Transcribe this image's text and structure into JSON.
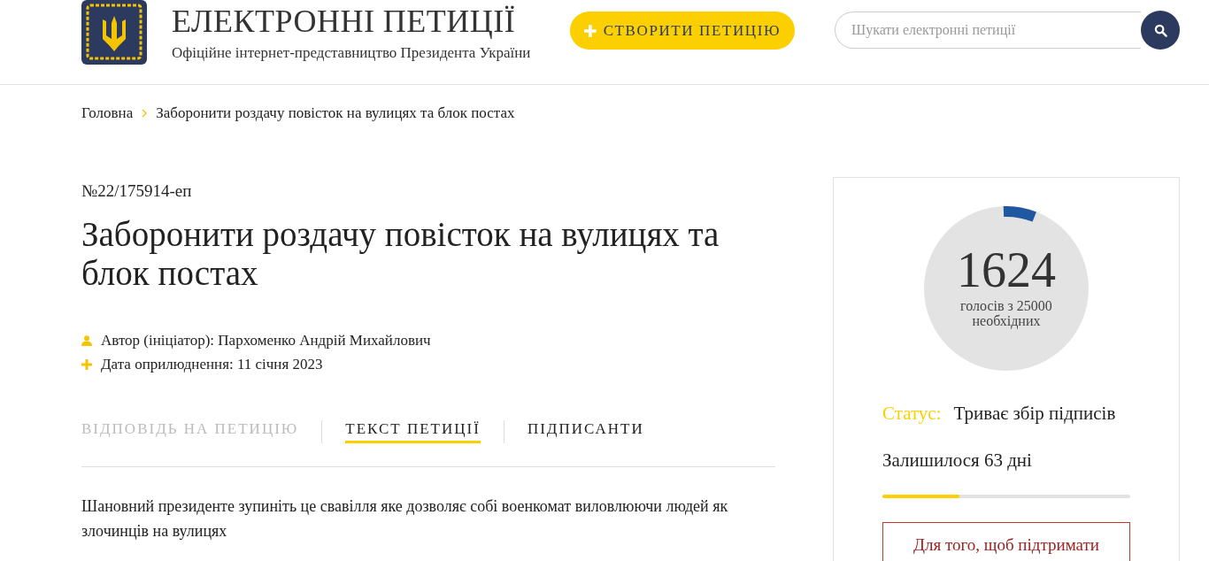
{
  "header": {
    "title": "ЕЛЕКТРОННІ ПЕТИЦІЇ",
    "subtitle": "Офіційне інтернет-представництво Президента України",
    "create_button": "СТВОРИТИ ПЕТИЦІЮ",
    "search": {
      "placeholder": "Шукати електронні петиції"
    }
  },
  "breadcrumbs": [
    "Головна",
    "Заборонити роздачу повісток на вулицях та блок постах"
  ],
  "petition": {
    "number": "№22/175914-еп",
    "title": "Заборонити роздачу повісток на вулицях та блок постах",
    "meta": [
      {
        "kind": "author",
        "text": "Автор (ініціатор): Пархоменко Андрій Михайлович"
      },
      {
        "kind": "date",
        "text": "Дата оприлюднення: 11 січня 2023"
      }
    ],
    "tabs": [
      {
        "label": "ВІДПОВІДЬ НА ПЕТИЦІЮ",
        "selected": false,
        "disabled": true
      },
      {
        "label": "ТЕКСТ ПЕТИЦІЇ",
        "selected": true,
        "disabled": false
      },
      {
        "label": "ПІДПИСАНТИ",
        "selected": false,
        "disabled": false
      }
    ],
    "text": "Шановний президенте зупиніть це свавілля яке дозволяє собі военкомат виловлюючи людей як злочинців на вулицях"
  },
  "sidebar": {
    "votes": "1624",
    "votes_caption": "голосів з 25000 необхідних",
    "status_label": "Статус:",
    "status": "Триває збір підписів",
    "remaining": "Залишилося 63 дні",
    "days": {
      "level": 0.31
    },
    "support_button": "Для того, щоб підтримати"
  }
}
